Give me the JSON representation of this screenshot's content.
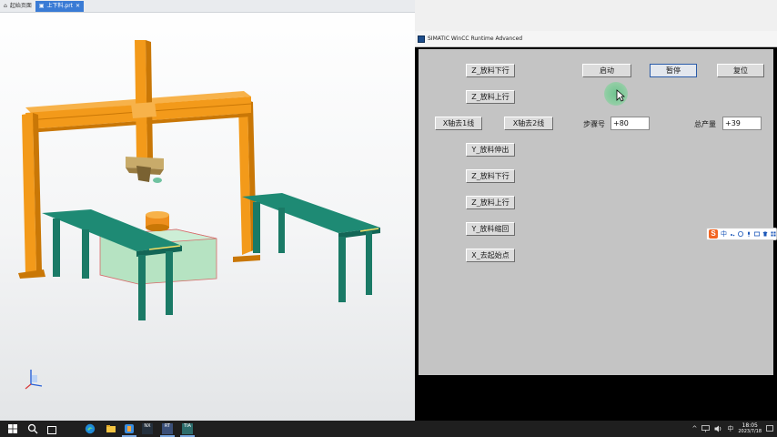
{
  "left_app": {
    "tabs": [
      {
        "label": "起始页面",
        "icon": "home-icon"
      },
      {
        "label": "上下料.prt",
        "icon": "part-file-icon"
      }
    ],
    "tab_close_symbol": "✕",
    "colors": {
      "gantry": "#f39a1a",
      "tables": "#1e8a74",
      "box": "#a9dcb7",
      "part": "#ee8f1e",
      "gripper": "#c0a060"
    }
  },
  "hmi": {
    "title": "SIMATIC WinCC Runtime Advanced",
    "buttons": {
      "z_down_1": "Z_放料下行",
      "z_up_1": "Z_放料上行",
      "x_line1": "X轴去1线",
      "x_line2": "X轴去2线",
      "y_out": "Y_放料伸出",
      "z_down_2": "Z_放料下行",
      "z_up_2": "Z_放料上行",
      "y_back": "Y_放料缩回",
      "x_origin": "X_去起始点",
      "start": "启动",
      "pause": "暂停",
      "reset": "复位"
    },
    "step_label": "步骤号",
    "step_value": "+80",
    "total_label": "总产量",
    "total_value": "+39"
  },
  "ime": {
    "logo": "S",
    "lang": "中",
    "icons": [
      "punct-icon",
      "smiley-icon",
      "microphone-icon",
      "keyboard-icon",
      "shirt-icon",
      "grid-icon"
    ]
  },
  "taskbar": {
    "icons": [
      "windows-start-icon",
      "search-icon",
      "task-view-icon",
      "edge-icon",
      "file-explorer-icon",
      "app-icon",
      "nx-icon",
      "wincc-rt-icon",
      "tia-portal-icon"
    ],
    "app_labels": {
      "app2": "NX",
      "app3": "RT",
      "app4": "TIA"
    },
    "tray": {
      "chevron": "^",
      "lang": "中"
    },
    "time": "18:05",
    "date": "2023/7/18"
  }
}
